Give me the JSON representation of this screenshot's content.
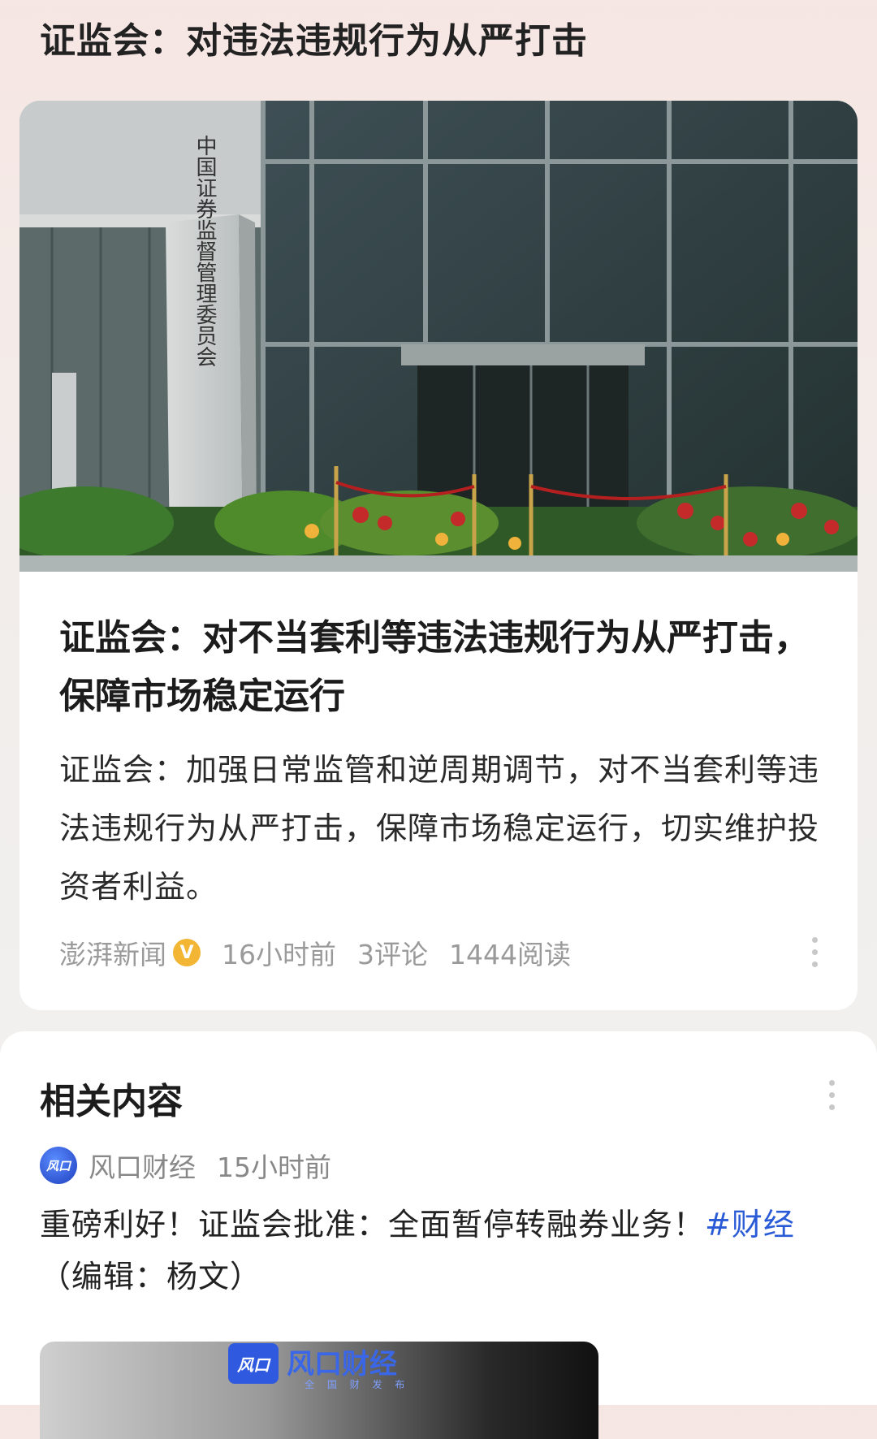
{
  "header": {
    "title": "证监会：对违法违规行为从严打击"
  },
  "article": {
    "image_alt": "中国证券监督管理委员会",
    "sign_text": "中国证券监督管理委员会",
    "title": "证监会：对不当套利等违法违规行为从严打击，保障市场稳定运行",
    "summary": "证监会：加强日常监管和逆周期调节，对不当套利等违法违规行为从严打击，保障市场稳定运行，切实维护投资者利益。",
    "source": "澎湃新闻",
    "verified_badge": "V",
    "time": "16小时前",
    "comments": "3评论",
    "reads": "1444阅读",
    "more_icon": "more-vertical-icon"
  },
  "related": {
    "title": "相关内容",
    "more_icon": "more-vertical-icon",
    "item": {
      "source_logo": "风口",
      "source": "风口财经",
      "time": "15小时前",
      "text": "重磅利好！证监会批准：全面暂停转融券业务！",
      "hashtag": "#财经",
      "editor": "（编辑：杨文）",
      "thumb_logo": "风口",
      "thumb_brand": "风口财经",
      "thumb_sub": "全 国 财 发 布"
    }
  },
  "colors": {
    "accent_link": "#2a5bd7",
    "verified": "#f2b534",
    "meta_gray": "#9a9a9a"
  }
}
